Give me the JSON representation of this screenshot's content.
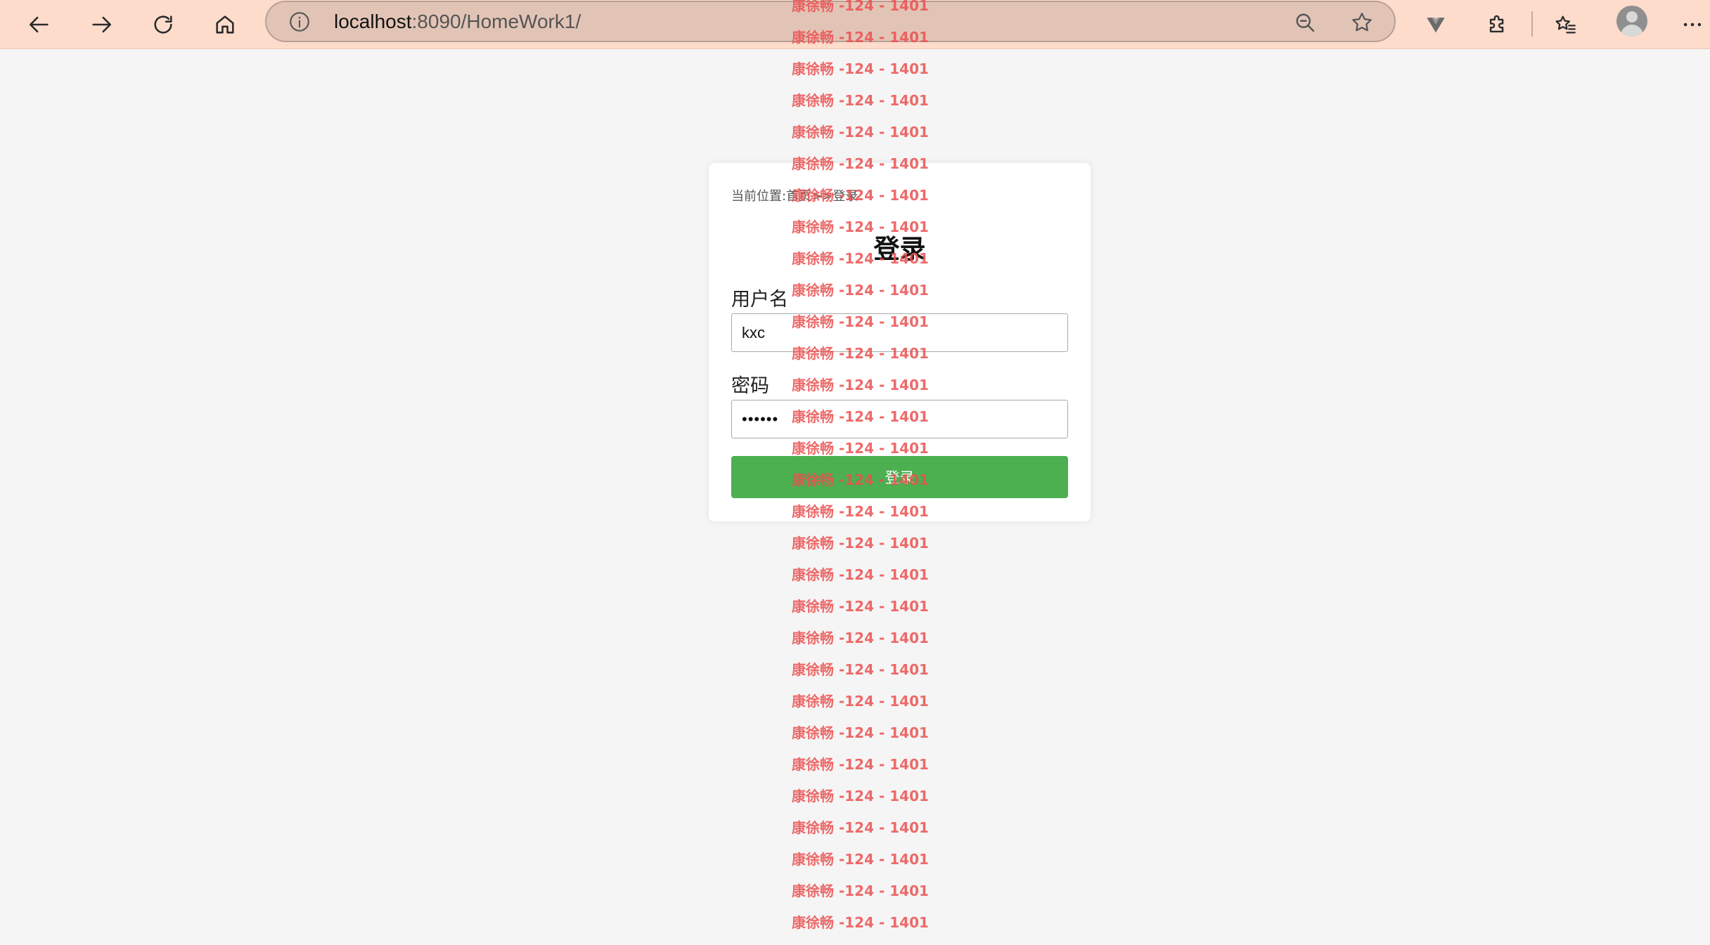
{
  "browser": {
    "url_host": "localhost",
    "url_path": ":8090/HomeWork1/",
    "icons": {
      "back": "arrow-left-icon",
      "forward": "arrow-right-icon",
      "refresh": "refresh-icon",
      "home": "home-icon",
      "site_info": "info-icon",
      "zoom": "zoom-out-icon",
      "favorite": "star-icon",
      "extension_v": "v-extension-icon",
      "extensions": "puzzle-icon",
      "favorites": "favorites-list-icon",
      "profile": "profile-avatar",
      "more": "more-icon"
    }
  },
  "page": {
    "breadcrumb": {
      "prefix": "当前位置:",
      "home": "首页",
      "separator": ">>",
      "current": "登录"
    },
    "title": "登录",
    "username": {
      "label": "用户名",
      "value": "kxc"
    },
    "password": {
      "label": "密码",
      "value": "••••••"
    },
    "submit_label": "登录",
    "accent_color": "#4caf50"
  },
  "watermark": {
    "text": "康徐畅 -124 - 1401",
    "color": "#eb5050"
  }
}
